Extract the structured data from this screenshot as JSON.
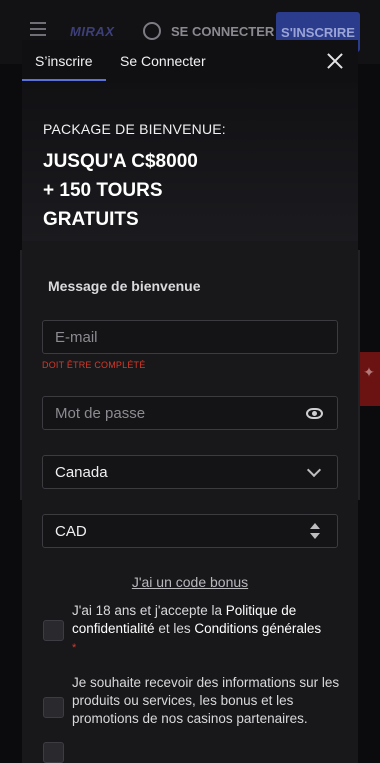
{
  "background": {
    "logo": "MIRAX",
    "login_label": "SE CONNECTER",
    "signup_label": "S'INSCRIRE"
  },
  "tabs": {
    "signup": "S’inscrire",
    "login": "Se Connecter"
  },
  "promo": {
    "kicker": "PACKAGE DE BIENVENUE:",
    "line1": "JUSQU'A C$8000",
    "line2": "+ 150 TOURS",
    "line3": "GRATUITS"
  },
  "form": {
    "section_title": "Message de bienvenue",
    "email_placeholder": "E-mail",
    "email_error": "DOIT ÊTRE COMPLÉTÉ",
    "password_placeholder": "Mot de passe",
    "country_value": "Canada",
    "currency_value": "CAD",
    "bonus_link": "J'ai un code bonus",
    "terms": {
      "prefix": "J'ai 18 ans et j'accepte la ",
      "privacy": "Politique de confidentialité",
      "middle": " et les ",
      "conditions": "Conditions générales",
      "required_mark": "*"
    },
    "marketing": "Je souhaite recevoir des informations sur les produits ou services, les bonus et les promotions de nos casinos partenaires."
  },
  "colors": {
    "accent": "#5b72d9",
    "error": "#d23a2a",
    "modal_bg": "#18181b"
  }
}
